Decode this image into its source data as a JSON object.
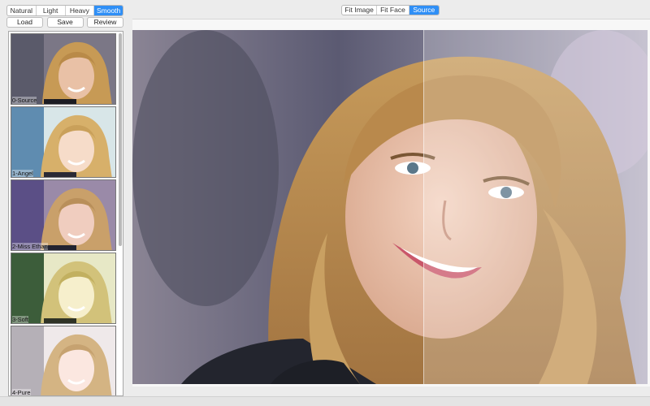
{
  "filters": {
    "tabs": [
      {
        "label": "Natural",
        "active": false
      },
      {
        "label": "Light",
        "active": false
      },
      {
        "label": "Heavy",
        "active": false
      },
      {
        "label": "Smooth",
        "active": true
      }
    ]
  },
  "actions": {
    "load_label": "Load",
    "save_label": "Save",
    "review_label": "Review"
  },
  "presets": [
    {
      "label": "0-Source"
    },
    {
      "label": "1-Angel"
    },
    {
      "label": "2-Miss Ethan"
    },
    {
      "label": "3-Soft"
    },
    {
      "label": "4-Pure"
    }
  ],
  "view": {
    "modes": [
      {
        "label": "Fit Image",
        "active": false
      },
      {
        "label": "Fit Face",
        "active": false
      },
      {
        "label": "Source",
        "active": true
      }
    ]
  },
  "colors": {
    "accent": "#2f8ff6",
    "panel_bg": "#ececec"
  }
}
